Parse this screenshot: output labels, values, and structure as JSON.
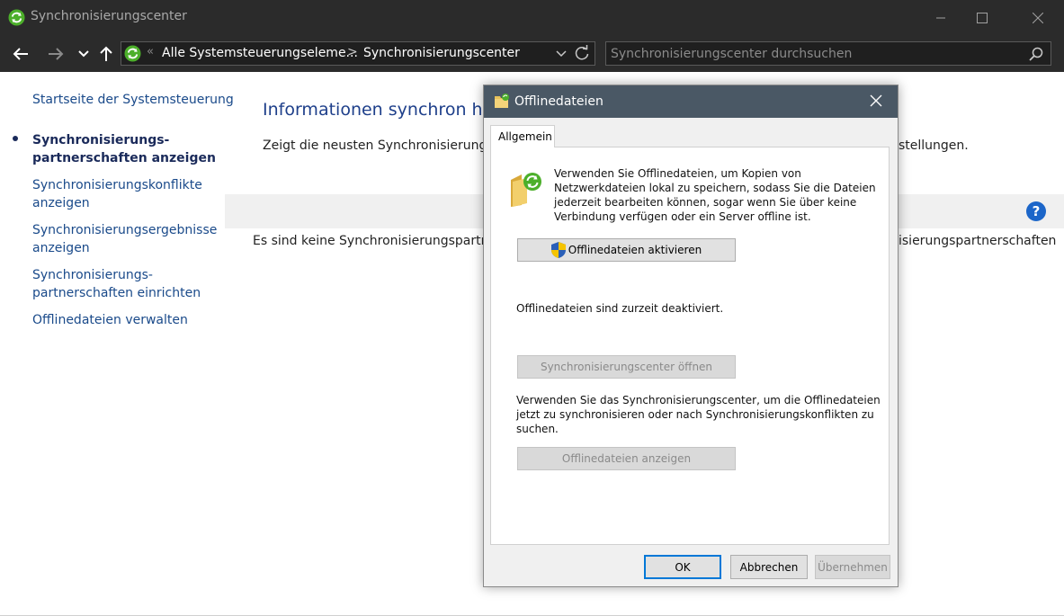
{
  "window": {
    "title": "Synchronisierungscenter",
    "app_icon": "sync-icon"
  },
  "address": {
    "separator_left": "«",
    "crumb1": "Alle Systemsteuerungseleme...",
    "separator_mid": ">",
    "crumb2": "Synchronisierungscenter"
  },
  "search": {
    "placeholder": "Synchronisierungscenter durchsuchen"
  },
  "sidebar": {
    "items": [
      {
        "label": "Startseite der Systemsteuerung"
      },
      {
        "label": "Synchronisierungs-",
        "label2": "partnerschaften anzeigen"
      },
      {
        "label": "Synchronisierungskonflikte",
        "label2": "anzeigen"
      },
      {
        "label": "Synchronisierungsergebnisse",
        "label2": "anzeigen"
      },
      {
        "label": "Synchronisierungs-",
        "label2": "partnerschaften einrichten"
      },
      {
        "label": "Offlinedateien verwalten"
      }
    ]
  },
  "main": {
    "heading": "Informationen synchron halt",
    "desc_left": "Zeigt die neusten Synchronisierungsa",
    "desc_right": "stellungen.",
    "empty_left": "Es sind keine Synchronisierungspartners",
    "empty_right": "isierungspartnerschaften",
    "help": "?"
  },
  "dialog": {
    "title": "Offlinedateien",
    "tab": "Allgemein",
    "intro_lines": [
      "Verwenden Sie Offlinedateien, um Kopien von",
      "Netzwerkdateien lokal zu speichern, sodass Sie die Dateien",
      "jederzeit bearbeiten können, sogar wenn Sie über keine",
      "Verbindung verfügen oder ein Server offline ist."
    ],
    "activate_button": "Offlinedateien aktivieren",
    "status": "Offlinedateien sind zurzeit deaktiviert.",
    "open_sync_button": "Synchronisierungscenter öffnen",
    "sync_lines": [
      "Verwenden Sie das Synchronisierungscenter, um die Offlinedateien",
      "jetzt zu synchronisieren oder nach Synchronisierungskonflikten zu",
      "suchen."
    ],
    "show_files_button": "Offlinedateien anzeigen",
    "ok": "OK",
    "cancel": "Abbrechen",
    "apply": "Übernehmen"
  },
  "colors": {
    "titlebar": "#2b2b2b",
    "link": "#1a4a8a",
    "heading": "#1e3f8a",
    "dialog_titlebar": "#4a5865",
    "accent": "#0078d7"
  }
}
